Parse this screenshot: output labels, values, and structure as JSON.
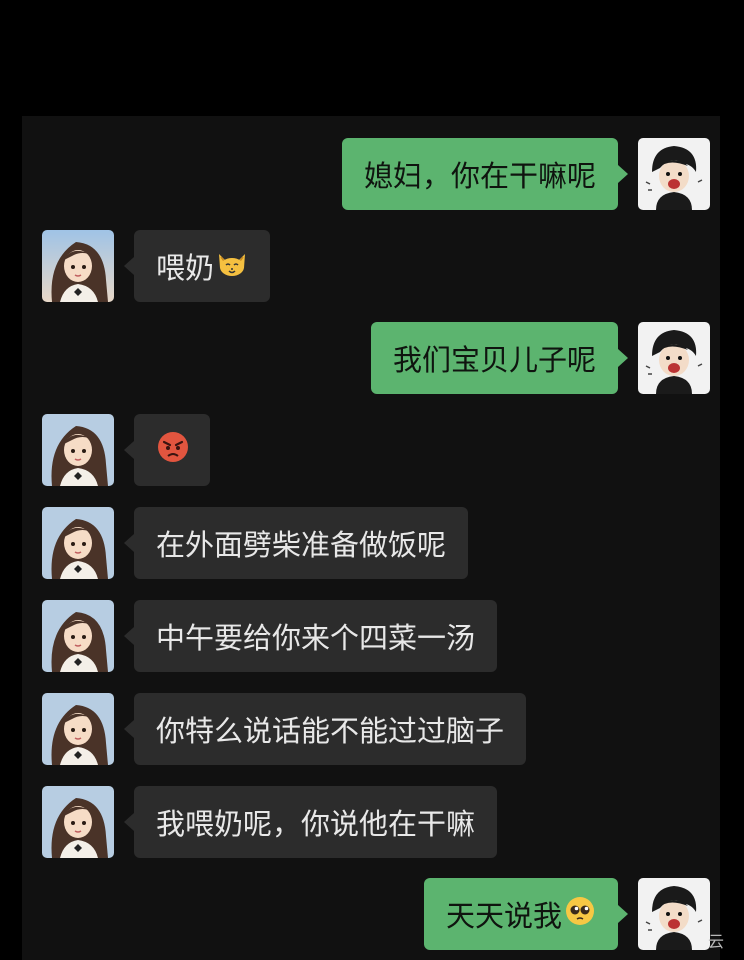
{
  "messages": [
    {
      "side": "out",
      "text": "媳妇，你在干嘛呢"
    },
    {
      "side": "in",
      "text": "喂奶",
      "emoji": "cat-face-emoji"
    },
    {
      "side": "out",
      "text": "我们宝贝儿子呢"
    },
    {
      "side": "in",
      "text": "",
      "emoji": "angry-face-emoji"
    },
    {
      "side": "in",
      "text": "在外面劈柴准备做饭呢"
    },
    {
      "side": "in",
      "text": "中午要给你来个四菜一汤"
    },
    {
      "side": "in",
      "text": "你特么说话能不能过过脑子"
    },
    {
      "side": "in",
      "text": "我喂奶呢，你说他在干嘛"
    },
    {
      "side": "out",
      "text": "天天说我",
      "emoji": "pleading-face-emoji"
    }
  ],
  "avatars": {
    "incoming": "girl-avatar",
    "outgoing": "boy-cartoon-avatar"
  },
  "watermark": "云",
  "colors": {
    "outgoing_bubble": "#5cb46f",
    "incoming_bubble": "#2c2c2c",
    "background": "#111111"
  }
}
